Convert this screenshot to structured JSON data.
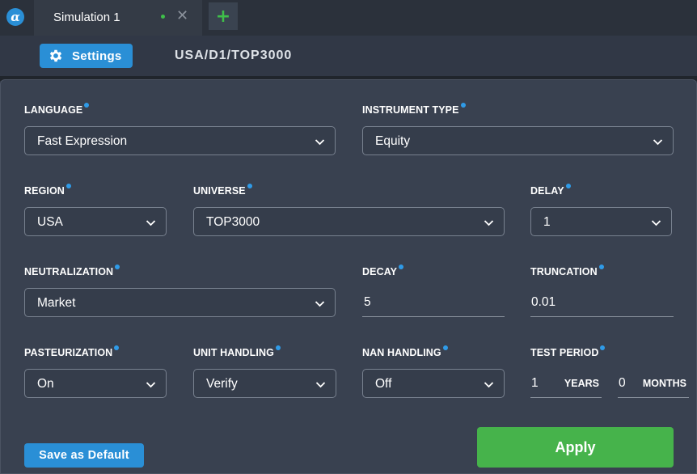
{
  "tab": {
    "title": "Simulation 1",
    "add_label": "+",
    "close_label": "✕"
  },
  "toolbar": {
    "settings_label": "Settings",
    "sim_path": "USA/D1/TOP3000"
  },
  "settings": {
    "language": {
      "label": "LANGUAGE",
      "value": "Fast Expression"
    },
    "instrument_type": {
      "label": "INSTRUMENT TYPE",
      "value": "Equity"
    },
    "region": {
      "label": "REGION",
      "value": "USA"
    },
    "universe": {
      "label": "UNIVERSE",
      "value": "TOP3000"
    },
    "delay": {
      "label": "DELAY",
      "value": "1"
    },
    "neutralization": {
      "label": "NEUTRALIZATION",
      "value": "Market"
    },
    "decay": {
      "label": "DECAY",
      "value": "5"
    },
    "truncation": {
      "label": "TRUNCATION",
      "value": "0.01"
    },
    "pasteurization": {
      "label": "PASTEURIZATION",
      "value": "On"
    },
    "unit_handling": {
      "label": "UNIT HANDLING",
      "value": "Verify"
    },
    "nan_handling": {
      "label": "NAN HANDLING",
      "value": "Off"
    },
    "test_period": {
      "label": "TEST PERIOD",
      "years_value": "1",
      "years_unit": "YEARS",
      "months_value": "0",
      "months_unit": "MONTHS"
    }
  },
  "buttons": {
    "save_default": "Save as Default",
    "apply": "Apply"
  },
  "colors": {
    "accent": "#2a8fd6",
    "apply": "#46b34b",
    "panel": "#394150",
    "dirty_dot": "#3fbf4a"
  },
  "icons": {
    "logo": "alpha-logo-icon",
    "gear": "gear-icon",
    "close": "close-icon",
    "add": "plus-icon",
    "chevron": "chevron-down-icon",
    "info": "info-dot-icon"
  }
}
